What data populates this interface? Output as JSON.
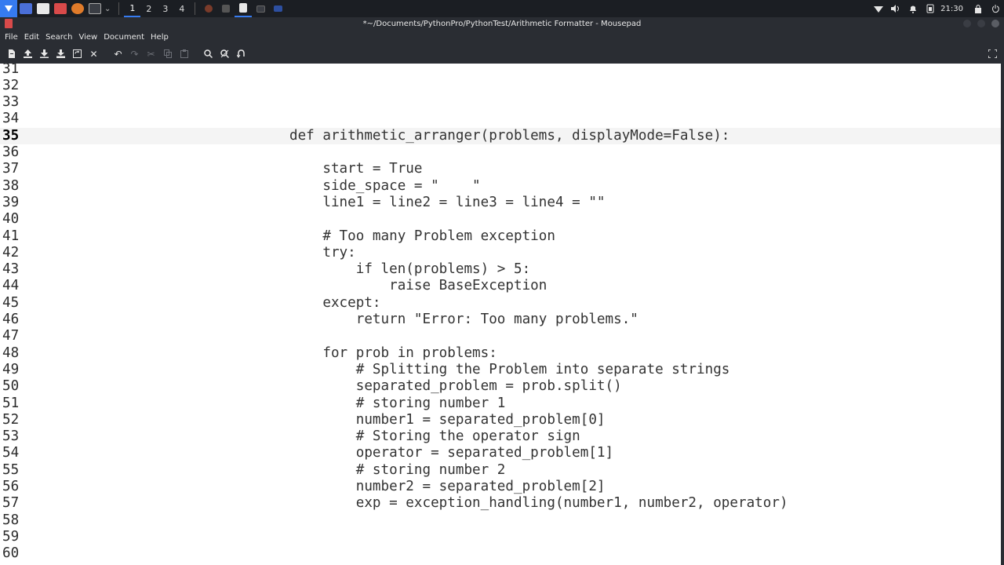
{
  "panel": {
    "workspaces": [
      "1",
      "2",
      "3",
      "4"
    ],
    "active_workspace": "1",
    "clock": "21:30",
    "accent": "#367bf0"
  },
  "window": {
    "title": "*~/Documents/PythonPro/PythonTest/Arithmetic Formatter - Mousepad"
  },
  "menu": [
    "File",
    "Edit",
    "Search",
    "View",
    "Document",
    "Help"
  ],
  "toolbar": {
    "icons": [
      "new-document-icon",
      "open-icon",
      "save-icon",
      "save-as-icon",
      "reload-icon",
      "close-document-icon",
      "undo-icon",
      "redo-icon",
      "cut-icon",
      "copy-icon",
      "paste-icon",
      "find-icon",
      "find-replace-icon",
      "goto-line-icon",
      "fullscreen-icon"
    ]
  },
  "editor": {
    "current_line": "35",
    "lines": [
      {
        "num": "31",
        "text": ""
      },
      {
        "num": "32",
        "text": ""
      },
      {
        "num": "33",
        "text": ""
      },
      {
        "num": "34",
        "text": ""
      },
      {
        "num": "35",
        "text": "def arithmetic_arranger(problems, displayMode=False):"
      },
      {
        "num": "36",
        "text": ""
      },
      {
        "num": "37",
        "text": "    start = True"
      },
      {
        "num": "38",
        "text": "    side_space = \"    \""
      },
      {
        "num": "39",
        "text": "    line1 = line2 = line3 = line4 = \"\""
      },
      {
        "num": "40",
        "text": ""
      },
      {
        "num": "41",
        "text": "    # Too many Problem exception"
      },
      {
        "num": "42",
        "text": "    try:"
      },
      {
        "num": "43",
        "text": "        if len(problems) > 5:"
      },
      {
        "num": "44",
        "text": "            raise BaseException"
      },
      {
        "num": "45",
        "text": "    except:"
      },
      {
        "num": "46",
        "text": "        return \"Error: Too many problems.\""
      },
      {
        "num": "47",
        "text": ""
      },
      {
        "num": "48",
        "text": "    for prob in problems:"
      },
      {
        "num": "49",
        "text": "        # Splitting the Problem into separate strings"
      },
      {
        "num": "50",
        "text": "        separated_problem = prob.split()"
      },
      {
        "num": "51",
        "text": "        # storing number 1"
      },
      {
        "num": "52",
        "text": "        number1 = separated_problem[0]"
      },
      {
        "num": "53",
        "text": "        # Storing the operator sign"
      },
      {
        "num": "54",
        "text": "        operator = separated_problem[1]"
      },
      {
        "num": "55",
        "text": "        # storing number 2"
      },
      {
        "num": "56",
        "text": "        number2 = separated_problem[2]"
      },
      {
        "num": "57",
        "text": "        exp = exception_handling(number1, number2, operator)"
      },
      {
        "num": "58",
        "text": ""
      },
      {
        "num": "59",
        "text": ""
      },
      {
        "num": "60",
        "text": ""
      }
    ]
  }
}
